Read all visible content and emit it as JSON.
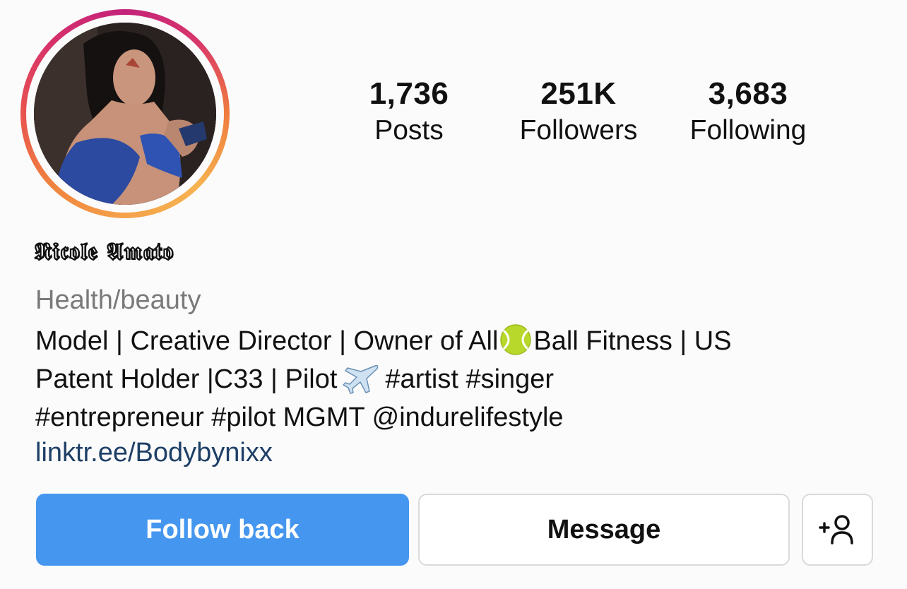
{
  "profile": {
    "display_name": "𝕹𝖎𝖈𝖔𝖑𝖊 𝕬𝖒𝖆𝖙𝖔",
    "category": "Health/beauty",
    "link": "linktr.ee/Bodybynixx"
  },
  "stats": {
    "posts": {
      "value": "1,736",
      "label": "Posts"
    },
    "followers": {
      "value": "251K",
      "label": "Followers"
    },
    "following": {
      "value": "3,683",
      "label": "Following"
    }
  },
  "bio": {
    "line1_a": "Model | Creative Director | Owner of All",
    "line1_emoji": "tennis-ball-icon",
    "line1_b": "Ball Fitness | US",
    "line2_a": "Patent Holder |C33 | Pilot",
    "line2_emoji": "airplane-icon",
    "line2_b": "#artist #singer",
    "line3": "#entrepreneur #pilot MGMT @indurelifestyle"
  },
  "actions": {
    "follow_back_label": "Follow back",
    "message_label": "Message",
    "add_user_icon": "add-user-icon"
  },
  "colors": {
    "follow_button": "#4596ef",
    "link": "#1e3f66",
    "category": "#7a7a7a",
    "story_ring_start": "#f4a24a",
    "story_ring_end": "#c3237a"
  }
}
